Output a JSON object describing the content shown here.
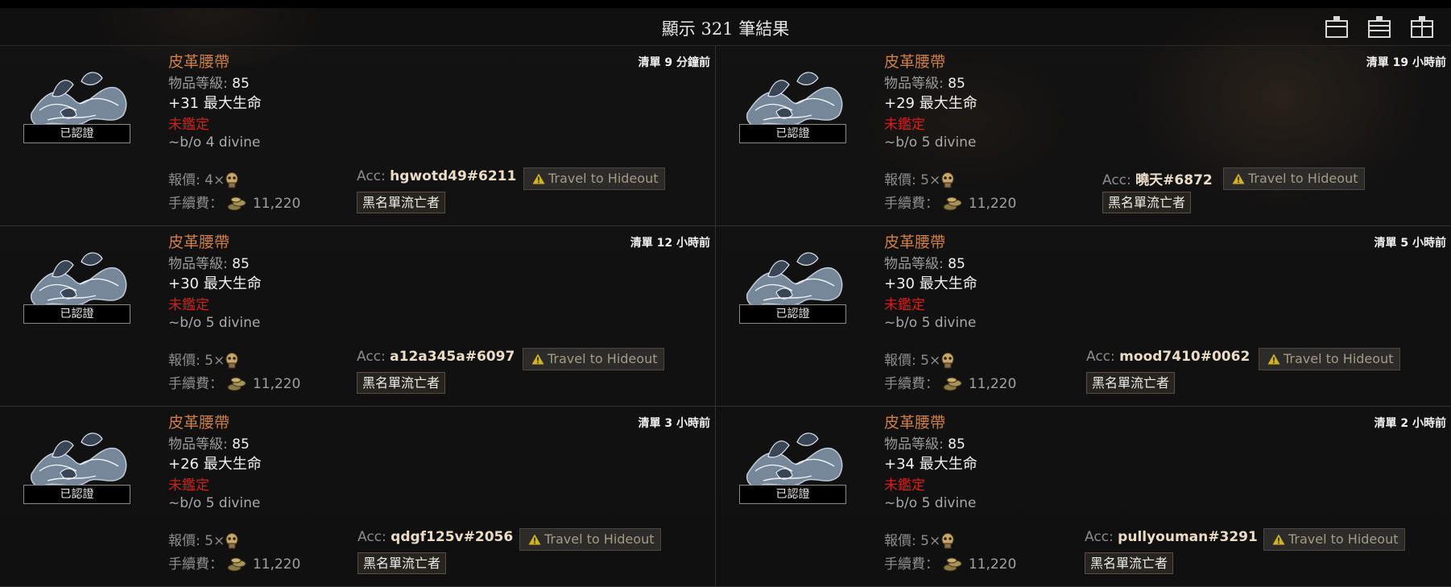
{
  "header": {
    "title": "顯示 321 筆結果"
  },
  "layout_buttons": [
    {
      "icon": "layout-collapsed-icon"
    },
    {
      "icon": "layout-expanded-icon"
    },
    {
      "icon": "layout-columns-icon"
    }
  ],
  "labels": {
    "verified": "已認證",
    "item_level": "物品等級:",
    "unidentified": "未鑑定",
    "price": "報價:",
    "fee": "手續費：",
    "acc": "Acc:",
    "travel": "Travel to Hideout",
    "block": "黑名單流亡者"
  },
  "colors": {
    "item_name": "#cd7e4a",
    "unidentified": "#d0221d",
    "accent_bg": "#121111"
  },
  "listings": [
    {
      "name": "皮革腰帶",
      "level": "85",
      "mod": "+31 最大生命",
      "note": "~b/o 4 divine",
      "price_amount": "4×",
      "fee_amount": "11,220",
      "listed": "清單 9 分鐘前",
      "account": "hgwotd49#6211",
      "currency_icon": "divine-orb-icon",
      "fee_icon": "gold-coins-icon"
    },
    {
      "name": "皮革腰帶",
      "level": "85",
      "mod": "+29 最大生命",
      "note": "~b/o 5 divine",
      "price_amount": "5×",
      "fee_amount": "11,220",
      "listed": "清單 19 小時前",
      "account": "曉天#6872",
      "currency_icon": "divine-orb-icon",
      "fee_icon": "gold-coins-icon"
    },
    {
      "name": "皮革腰帶",
      "level": "85",
      "mod": "+30 最大生命",
      "note": "~b/o 5 divine",
      "price_amount": "5×",
      "fee_amount": "11,220",
      "listed": "清單 12 小時前",
      "account": "a12a345a#6097",
      "currency_icon": "divine-orb-icon",
      "fee_icon": "gold-coins-icon"
    },
    {
      "name": "皮革腰帶",
      "level": "85",
      "mod": "+30 最大生命",
      "note": "~b/o 5 divine",
      "price_amount": "5×",
      "fee_amount": "11,220",
      "listed": "清單 5 小時前",
      "account": "mood7410#0062",
      "currency_icon": "divine-orb-icon",
      "fee_icon": "gold-coins-icon"
    },
    {
      "name": "皮革腰帶",
      "level": "85",
      "mod": "+26 最大生命",
      "note": "~b/o 5 divine",
      "price_amount": "5×",
      "fee_amount": "11,220",
      "listed": "清單 3 小時前",
      "account": "qdgf125v#2056",
      "currency_icon": "divine-orb-icon",
      "fee_icon": "gold-coins-icon"
    },
    {
      "name": "皮革腰帶",
      "level": "85",
      "mod": "+34 最大生命",
      "note": "~b/o 5 divine",
      "price_amount": "5×",
      "fee_amount": "11,220",
      "listed": "清單 2 小時前",
      "account": "pullyouman#3291",
      "currency_icon": "divine-orb-icon",
      "fee_icon": "gold-coins-icon"
    }
  ]
}
